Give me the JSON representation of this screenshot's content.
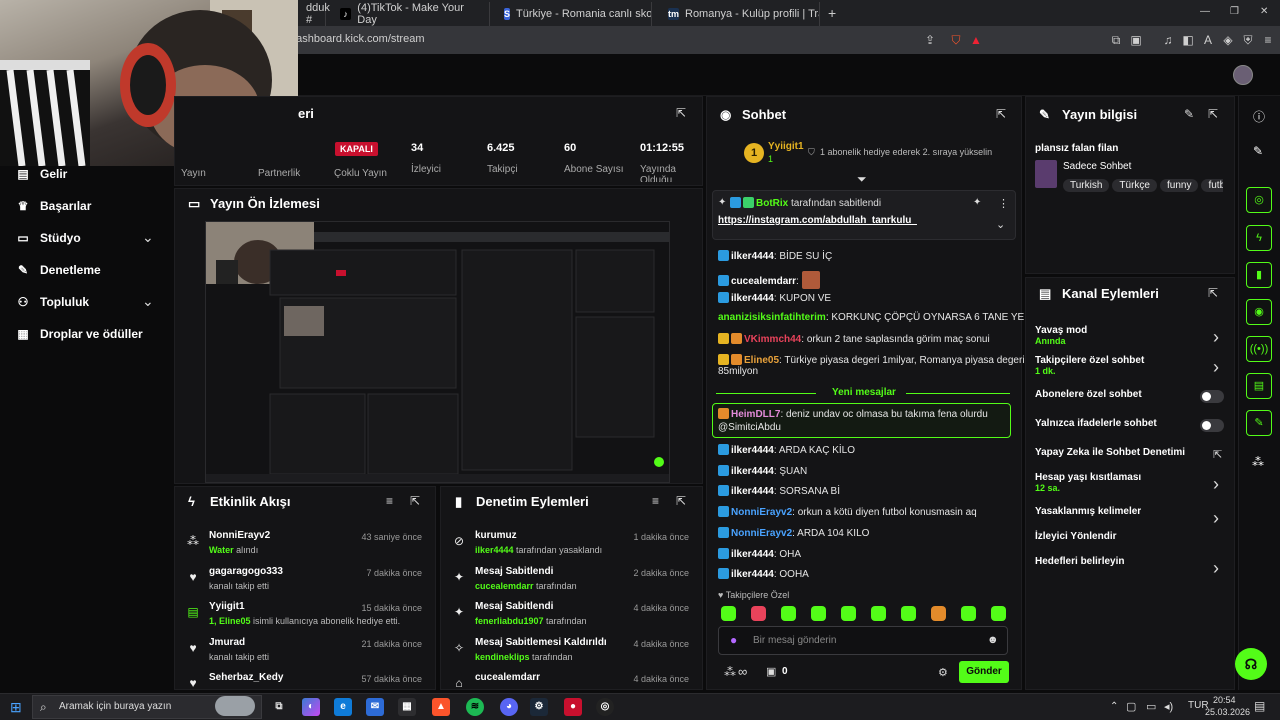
{
  "browser": {
    "tabs": [
      {
        "label": "dduk #",
        "icon": "kick-icon"
      },
      {
        "label": "(4)TikTok - Make Your Day",
        "icon": "tiktok-icon"
      },
      {
        "label": "Türkiye - Romania canlı skor, baş baş",
        "icon": "sofascore-icon"
      },
      {
        "label": "Romanya - Kulüp profili | Transferma",
        "icon": "transfermarkt-icon"
      }
    ],
    "new_tab": "+",
    "url": "dashboard.kick.com/stream",
    "window_controls": [
      "—",
      "❐",
      "✕"
    ]
  },
  "sidebar": {
    "items": [
      {
        "label": "Gelir",
        "icon": "money-icon",
        "has_chevron": false
      },
      {
        "label": "Başarılar",
        "icon": "trophy-icon",
        "has_chevron": false
      },
      {
        "label": "Stüdyo",
        "icon": "studio-icon",
        "has_chevron": true
      },
      {
        "label": "Denetleme",
        "icon": "wrench-icon",
        "has_chevron": false
      },
      {
        "label": "Topluluk",
        "icon": "community-icon",
        "has_chevron": true
      },
      {
        "label": "Droplar ve ödüller",
        "icon": "drops-icon",
        "has_chevron": false
      }
    ]
  },
  "stats": {
    "title_fragment": "eri",
    "status_badge": "KAPALI",
    "labels": [
      "Yayın",
      "Partnerlik",
      "Çoklu Yayın",
      "İzleyici",
      "Takipçi",
      "Abone Sayısı",
      "Yayında Olduğu"
    ],
    "viewers": "34",
    "followers": "6.425",
    "subs": "60",
    "uptime": "01:12:55"
  },
  "preview": {
    "title": "Yayın Ön İzlemesi"
  },
  "activity": {
    "title": "Etkinlik Akışı",
    "rows": [
      {
        "icon": "gift-icon",
        "title": "NonniErayv2",
        "sub_hl": "Water",
        "sub": " alındı",
        "time": "43 saniye önce"
      },
      {
        "icon": "heart-icon",
        "title": "gagaragogo333",
        "sub_hl": "",
        "sub": "kanalı takip etti",
        "time": "7 dakika önce"
      },
      {
        "icon": "sub-icon",
        "title": "Yyiigit1",
        "sub_hl": "1, Eline05",
        "sub": " isimli kullanıcıya abonelik hediye etti.",
        "time": "15 dakika önce"
      },
      {
        "icon": "heart-icon",
        "title": "Jmurad",
        "sub_hl": "",
        "sub": "kanalı takip etti",
        "time": "21 dakika önce"
      },
      {
        "icon": "heart-icon",
        "title": "Seherbaz_Kedy",
        "sub_hl": "",
        "sub": "",
        "time": "57 dakika önce"
      }
    ]
  },
  "modactions": {
    "title": "Denetim Eylemleri",
    "rows": [
      {
        "icon": "ban-icon",
        "title": "kurumuz",
        "sub_hl": "ilker4444",
        "sub": " tarafından yasaklandı",
        "time": "1 dakika önce"
      },
      {
        "icon": "pin-icon",
        "title": "Mesaj Sabitlendi",
        "sub_hl": "cucealemdarr",
        "sub": " tarafından",
        "time": "2 dakika önce"
      },
      {
        "icon": "pin-icon",
        "title": "Mesaj Sabitlendi",
        "sub_hl": "fenerliabdu1907",
        "sub": " tarafından",
        "time": "4 dakika önce"
      },
      {
        "icon": "unpin-icon",
        "title": "Mesaj Sabitlemesi Kaldırıldı",
        "sub_hl": "kendineklips",
        "sub": " tarafından",
        "time": "4 dakika önce"
      },
      {
        "icon": "hat-icon",
        "title": "cucealemdarr",
        "sub_hl": "",
        "sub": "",
        "time": "4 dakika önce"
      }
    ]
  },
  "chat": {
    "title": "Sohbet",
    "top_gifter": "Yyiigit1",
    "top_gifter_count": "1",
    "gift_notice": "1 abonelik hediye ederek 2. sıraya yükselin",
    "pinned_by": "BotRix",
    "pinned_suffix": "tarafından sabitlendi",
    "pinned_link": "https://instagram.com/abdullah_tanrkulu_",
    "messages": [
      {
        "user": "ilker4444",
        "color": "#ffffff",
        "badge": "b-blue",
        "text": "BİDE SU İÇ"
      },
      {
        "user": "cucealemdarr",
        "color": "#ffffff",
        "badge": "b-blue",
        "text": "",
        "emote": true
      },
      {
        "user": "ilker4444",
        "color": "#ffffff",
        "badge": "b-blue",
        "text": "KUPON VE"
      },
      {
        "user": "ananizisiksinfatihterim",
        "color": "#53fc18",
        "badge": "",
        "text": "KORKUNÇ ÇÖPÇÜ OYNARSA 6 TANE YERİZ"
      },
      {
        "user": "VKimmch44",
        "color": "#e9435b",
        "badge": "b-gold",
        "text": "orkun 2 tane saplasında görim maç sonui"
      },
      {
        "user": "Eline05",
        "color": "#e9a23b",
        "badge": "b-gold",
        "text": "Türkiye piyasa degeri 1milyar, Romanya piyasa degeri"
      }
    ],
    "msg_cont": "85milyon",
    "new_messages": "Yeni mesajlar",
    "highlight_user": "HeimDLL7",
    "highlight_text": "deniz undav oc olmasa bu takıma fena olurdu",
    "highlight_cont": "@SimitciAbdu",
    "messages2": [
      {
        "user": "ilker4444",
        "color": "#ffffff",
        "badge": "b-blue",
        "text": "ARDA KAÇ KİLO"
      },
      {
        "user": "ilker4444",
        "color": "#ffffff",
        "badge": "b-blue",
        "text": "ŞUAN"
      },
      {
        "user": "ilker4444",
        "color": "#ffffff",
        "badge": "b-blue",
        "text": "SORSANA Bİ"
      },
      {
        "user": "NonniErayv2",
        "color": "#4aa3ff",
        "badge": "b-blue",
        "text": "orkun a kötü diyen futbol konusmasin aq"
      },
      {
        "user": "NonniErayv2",
        "color": "#4aa3ff",
        "badge": "b-blue",
        "text": "ARDA 104 KILO"
      },
      {
        "user": "ilker4444",
        "color": "#ffffff",
        "badge": "b-blue",
        "text": "OHA"
      },
      {
        "user": "ilker4444",
        "color": "#ffffff",
        "badge": "b-blue",
        "text": "OOHA"
      }
    ],
    "followers_only_label": "Takipçilere Özel",
    "emote_colors": [
      "#53fc18",
      "#e9435b",
      "#53fc18",
      "#53fc18",
      "#53fc18",
      "#53fc18",
      "#53fc18",
      "#e38b2b",
      "#53fc18",
      "#53fc18"
    ],
    "input_placeholder": "Bir mesaj gönderin",
    "infinity": "∞",
    "points": "0",
    "send_label": "Gönder"
  },
  "stream_info": {
    "title": "Yayın bilgisi",
    "stream_title": "plansız falan filan",
    "category": "Sadece Sohbet",
    "tags": [
      "Turkish",
      "Türkçe",
      "funny",
      "futbo"
    ]
  },
  "channel_actions": {
    "title": "Kanal Eylemleri",
    "rows": [
      {
        "label": "Yavaş mod",
        "sub": "Anında",
        "control": "chevron"
      },
      {
        "label": "Takipçilere özel sohbet",
        "sub": "1 dk.",
        "control": "chevron"
      },
      {
        "label": "Abonelere özel sohbet",
        "sub": "",
        "control": "toggle"
      },
      {
        "label": "Yalnızca ifadelerle sohbet",
        "sub": "",
        "control": "toggle"
      },
      {
        "label": "Yapay Zeka ile Sohbet Denetimi",
        "sub": "",
        "control": "external"
      },
      {
        "label": "Hesap yaşı kısıtlaması",
        "sub": "12 sa.",
        "control": "chevron"
      },
      {
        "label": "Yasaklanmış kelimeler",
        "sub": "",
        "control": "chevron"
      },
      {
        "label": "İzleyici Yönlendir",
        "sub": "",
        "control": "none"
      },
      {
        "label": "Hedefleri belirleyin",
        "sub": "",
        "control": "chevron"
      }
    ]
  },
  "taskbar": {
    "search_placeholder": "Aramak için buraya yazın",
    "time": "20:54",
    "date": "25.03.2026"
  },
  "colors": {
    "accent": "#53fc18",
    "panel": "#141416",
    "bg": "#0b0b0c"
  }
}
